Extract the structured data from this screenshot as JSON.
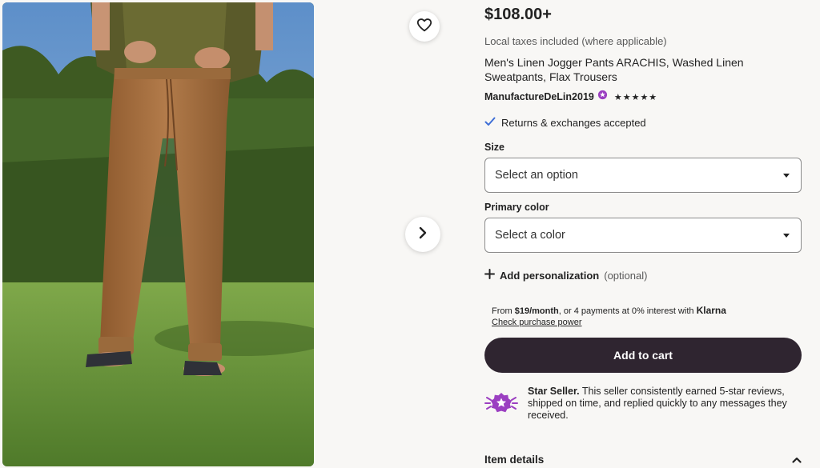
{
  "listing": {
    "price": "$108.00+",
    "tax_note": "Local taxes included (where applicable)",
    "title": "Men's Linen Jogger Pants ARACHIS, Washed Linen Sweatpants, Flax Trousers",
    "shop_name": "ManufactureDeLin2019",
    "rating_stars": "★★★★★",
    "returns_text": "Returns & exchanges accepted"
  },
  "size": {
    "label": "Size",
    "value": "Select an option"
  },
  "color": {
    "label": "Primary color",
    "value": "Select a color"
  },
  "personalization": {
    "label": "Add personalization",
    "optional": "(optional)"
  },
  "klarna": {
    "prefix": "From ",
    "amount": "$19/month",
    "middle": ", or 4 payments at 0% interest with ",
    "brand": "Klarna",
    "link": "Check purchase power"
  },
  "cart": {
    "label": "Add to cart"
  },
  "star_seller": {
    "title": "Star Seller.",
    "text": "This seller consistently earned 5-star reviews, shipped on time, and replied quickly to any messages they received."
  },
  "item_details": {
    "label": "Item details"
  },
  "colors": {
    "accent": "#2f2530",
    "star_seller_purple": "#9b3fc1",
    "check_blue": "#3f6fd6"
  }
}
